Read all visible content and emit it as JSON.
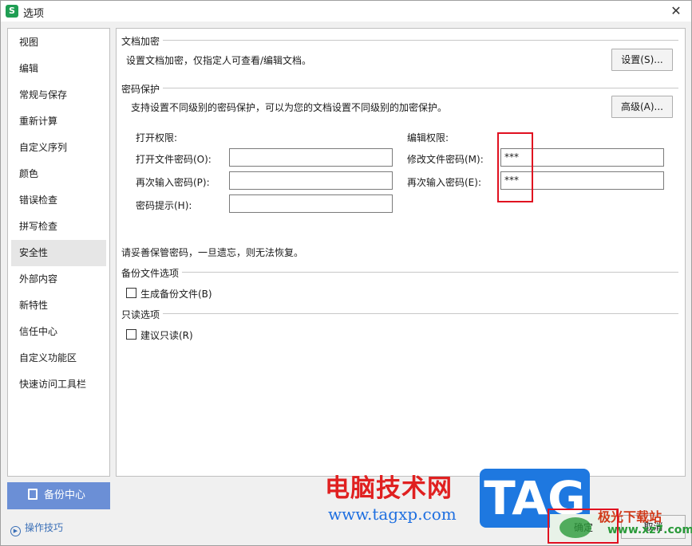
{
  "window": {
    "title": "选项",
    "app_icon_letter": "S",
    "close_glyph": "✕"
  },
  "sidebar": {
    "items": [
      {
        "label": "视图"
      },
      {
        "label": "编辑"
      },
      {
        "label": "常规与保存"
      },
      {
        "label": "重新计算"
      },
      {
        "label": "自定义序列"
      },
      {
        "label": "颜色"
      },
      {
        "label": "错误检查"
      },
      {
        "label": "拼写检查"
      },
      {
        "label": "安全性",
        "active": true
      },
      {
        "label": "外部内容"
      },
      {
        "label": "新特性"
      },
      {
        "label": "信任中心"
      },
      {
        "label": "自定义功能区"
      },
      {
        "label": "快速访问工具栏"
      }
    ],
    "backup_label": "备份中心",
    "tips_label": "操作技巧"
  },
  "encryption": {
    "title": "文档加密",
    "desc": "设置文档加密，仅指定人可查看/编辑文档。",
    "settings_button": "设置(S)..."
  },
  "password": {
    "title": "密码保护",
    "desc": "支持设置不同级别的密码保护，可以为您的文档设置不同级别的加密保护。",
    "advanced_button": "高级(A)...",
    "open_heading": "打开权限:",
    "open_password_label": "打开文件密码(O):",
    "open_password_value": "",
    "open_confirm_label": "再次输入密码(P):",
    "open_confirm_value": "",
    "hint_label": "密码提示(H):",
    "hint_value": "",
    "edit_heading": "编辑权限:",
    "edit_password_label": "修改文件密码(M):",
    "edit_password_value": "***",
    "edit_confirm_label": "再次输入密码(E):",
    "edit_confirm_value": "***",
    "warning": "请妥善保管密码，一旦遗忘，则无法恢复。"
  },
  "backup": {
    "title": "备份文件选项",
    "checkbox_label": "生成备份文件(B)",
    "checked": false
  },
  "readonly": {
    "title": "只读选项",
    "checkbox_label": "建议只读(R)",
    "checked": false
  },
  "footer": {
    "ok_label": "确定",
    "cancel_label": "取消"
  },
  "watermark": {
    "site_cn": "电脑技术网",
    "url": "www.tagxp.com",
    "tag": "TAG",
    "site2": "极光下载站",
    "site2_url": "www.xz7.com"
  },
  "colors": {
    "accent": "#6b8fd6",
    "highlight": "#e01020",
    "app_icon": "#1f9e53"
  }
}
